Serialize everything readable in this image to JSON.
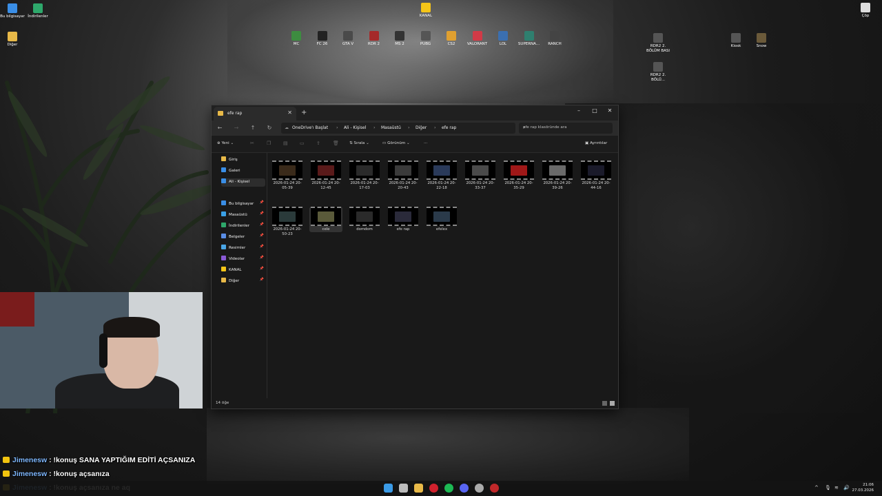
{
  "desktop": {
    "icons_left": [
      {
        "label": "Bu bilgisayar",
        "color": "#3a8ee6"
      },
      {
        "label": "İndirilenler",
        "color": "#2ea86b"
      },
      {
        "label": "Diğer",
        "color": "#e8b948"
      }
    ],
    "icon_kanal": {
      "label": "KANAL",
      "color": "#f5c518"
    },
    "games": [
      {
        "label": "MC",
        "color": "#3d8c40"
      },
      {
        "label": "FC 26",
        "color": "#222222"
      },
      {
        "label": "GTA V",
        "color": "#4a4a4a"
      },
      {
        "label": "RDR 2",
        "color": "#a52a2a"
      },
      {
        "label": "MS 2",
        "color": "#333333"
      },
      {
        "label": "PUBG",
        "color": "#555555"
      },
      {
        "label": "CS2",
        "color": "#e0a030"
      },
      {
        "label": "VALORANT",
        "color": "#d13a47"
      },
      {
        "label": "LOL",
        "color": "#3b6fb0"
      },
      {
        "label": "SUPERNA...",
        "color": "#2f7f6f"
      },
      {
        "label": "RANCH",
        "color": "#444444"
      }
    ],
    "right_icons": [
      {
        "label": "RDR2 2. BÖLÜM BASI",
        "color": "#555555"
      },
      {
        "label": "RDR2 2. BÖLÜ...",
        "color": "#555555"
      },
      {
        "label": "Kiosk",
        "color": "#555555"
      },
      {
        "label": "Snow",
        "color": "#6b5a3a"
      },
      {
        "label": "Çöp",
        "color": "#dddddd"
      }
    ]
  },
  "explorer": {
    "tab_title": "efe rap",
    "new_tab": "+",
    "window_controls": {
      "minimize": "–",
      "maximize": "□",
      "close": "✕"
    },
    "nav": {
      "back": "←",
      "forward": "→",
      "up": "↑",
      "refresh": "↻"
    },
    "breadcrumb": [
      "OneDrive'ı Başlat",
      "Ali - Kişisel",
      "Masaüstü",
      "Diğer",
      "efe rap"
    ],
    "breadcrumb_sep": "›",
    "search_placeholder": "efe rap klasöründe ara",
    "command_bar": {
      "new": "Yeni",
      "sort": "Sırala",
      "view": "Görünüm",
      "more": "···",
      "details": "Ayrıntılar"
    },
    "sidebar": [
      {
        "label": "Giriş",
        "color": "#e8b948",
        "pinned": false
      },
      {
        "label": "Galeri",
        "color": "#3a8ee6",
        "pinned": false
      },
      {
        "label": "Ali - Kişisel",
        "color": "#3a8ee6",
        "pinned": false,
        "selected": true
      },
      {
        "label": "Bu bilgisayar",
        "color": "#3a8ee6",
        "pinned": true
      },
      {
        "label": "Masaüstü",
        "color": "#3aa0e6",
        "pinned": true
      },
      {
        "label": "İndirilenler",
        "color": "#2ea86b",
        "pinned": true
      },
      {
        "label": "Belgeler",
        "color": "#5a8ee6",
        "pinned": true
      },
      {
        "label": "Resimler",
        "color": "#4aa6e6",
        "pinned": true
      },
      {
        "label": "Videolar",
        "color": "#8a5ad6",
        "pinned": true
      },
      {
        "label": "KANAL",
        "color": "#f5c518",
        "pinned": true
      },
      {
        "label": "Diğer",
        "color": "#e8b948",
        "pinned": true
      }
    ],
    "files": [
      {
        "name": "2026-01-24 20-05-39",
        "color": "#3a2a1a"
      },
      {
        "name": "2026-01-24 20-12-45",
        "color": "#5a1a1a"
      },
      {
        "name": "2026-01-24 20-17-03",
        "color": "#2a2a2a"
      },
      {
        "name": "2026-01-24 20-20-43",
        "color": "#3a3a3a"
      },
      {
        "name": "2026-01-24 20-22-18",
        "color": "#2a3a5a"
      },
      {
        "name": "2026-01-24 20-33-37",
        "color": "#4a4a4a"
      },
      {
        "name": "2026-01-24 20-35-29",
        "color": "#a01818"
      },
      {
        "name": "2026-01-24 20-39-26",
        "color": "#6a6a6a"
      },
      {
        "name": "2026-01-24 20-44-16",
        "color": "#1a1a2a"
      },
      {
        "name": "2026-01-24 20-50-23",
        "color": "#2a3a3a"
      },
      {
        "name": "cele",
        "color": "#5a5a3a"
      },
      {
        "name": "domdom",
        "color": "#2a2a2a"
      },
      {
        "name": "efe rap",
        "color": "#2a2a3a"
      },
      {
        "name": "efelex",
        "color": "#2a3a4a"
      }
    ],
    "status": "14 öğe"
  },
  "chat": [
    {
      "user": "Jimenesw",
      "message": ": !konuş SANA YAPTIĞIM EDİTİ AÇSANIZA"
    },
    {
      "user": "Jimenesw",
      "message": ": !konuş açsanıza"
    },
    {
      "user": "Jimenesw",
      "message": ": !konuş açsanıza ne aq"
    }
  ],
  "taskbar": {
    "apps": [
      {
        "name": "start",
        "color": "#3a9ae6"
      },
      {
        "name": "task-view",
        "color": "#bbbbbb"
      },
      {
        "name": "file-explorer",
        "color": "#e8b948"
      },
      {
        "name": "opera",
        "color": "#d0212d"
      },
      {
        "name": "spotify",
        "color": "#1db954"
      },
      {
        "name": "discord",
        "color": "#5865f2"
      },
      {
        "name": "steam",
        "color": "#aaaaaa"
      },
      {
        "name": "obs",
        "color": "#c0282a"
      }
    ],
    "tray": {
      "chevron": "^",
      "mic": "🎙",
      "wifi": "≋",
      "volume": "🔊"
    },
    "time": "21:06",
    "date": "27.03.2026"
  }
}
